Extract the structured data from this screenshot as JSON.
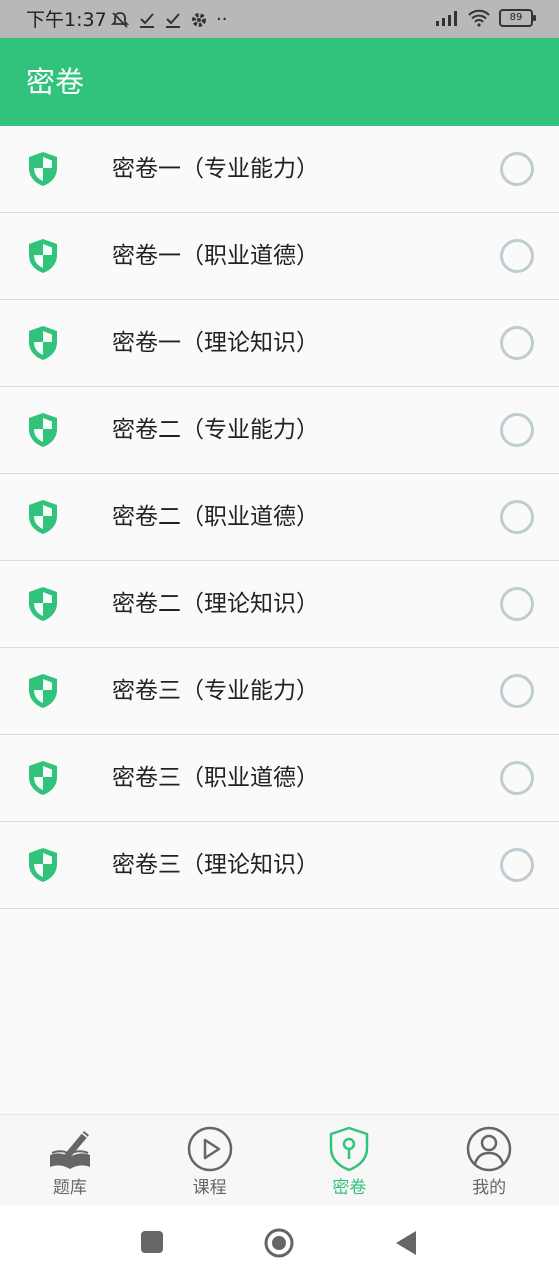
{
  "status_bar": {
    "time": "下午1:37",
    "battery": "89",
    "more": "··"
  },
  "app_bar": {
    "title": "密卷"
  },
  "items": [
    {
      "label": "密卷一（专业能力）"
    },
    {
      "label": "密卷一（职业道德）"
    },
    {
      "label": "密卷一（理论知识）"
    },
    {
      "label": "密卷二（专业能力）"
    },
    {
      "label": "密卷二（职业道德）"
    },
    {
      "label": "密卷二（理论知识）"
    },
    {
      "label": "密卷三（专业能力）"
    },
    {
      "label": "密卷三（职业道德）"
    },
    {
      "label": "密卷三（理论知识）"
    }
  ],
  "bottom_nav": [
    {
      "label": "题库",
      "icon": "book-pencil-icon",
      "active": false
    },
    {
      "label": "课程",
      "icon": "play-circle-icon",
      "active": false
    },
    {
      "label": "密卷",
      "icon": "shield-key-icon",
      "active": true
    },
    {
      "label": "我的",
      "icon": "user-circle-icon",
      "active": false
    }
  ],
  "colors": {
    "accent": "#31c27c",
    "radio_border": "#bfccd2",
    "status_bar": "#b8b8b8"
  }
}
